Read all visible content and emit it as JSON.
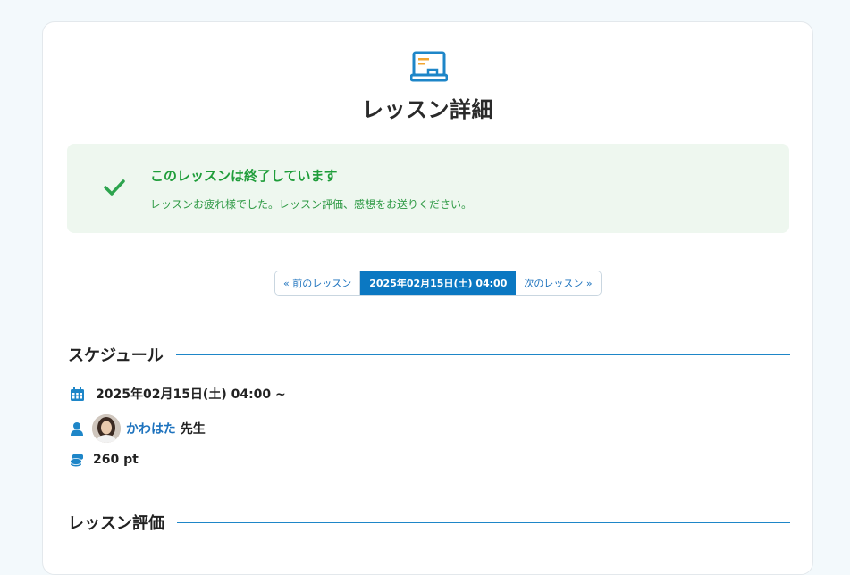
{
  "page": {
    "title": "レッスン詳細",
    "icon": "laptop-icon"
  },
  "alert": {
    "icon": "check-icon",
    "title": "このレッスンは終了しています",
    "message": "レッスンお疲れ様でした。レッスン評価、感想をお送りください。"
  },
  "pager": {
    "prev": "« 前のレッスン",
    "current": "2025年02月15日(土) 04:00",
    "next": "次のレッスン »"
  },
  "schedule": {
    "heading": "スケジュール",
    "datetime": "2025年02月15日(土) 04:00 ~",
    "teacher_name": "かわはた",
    "teacher_suffix": "先生",
    "points": "260 pt"
  },
  "review": {
    "heading": "レッスン評価"
  },
  "colors": {
    "accent": "#0b78c2",
    "success": "#1f9d3a",
    "alert_bg": "#eef7ef",
    "page_bg": "#f3f9fc"
  }
}
